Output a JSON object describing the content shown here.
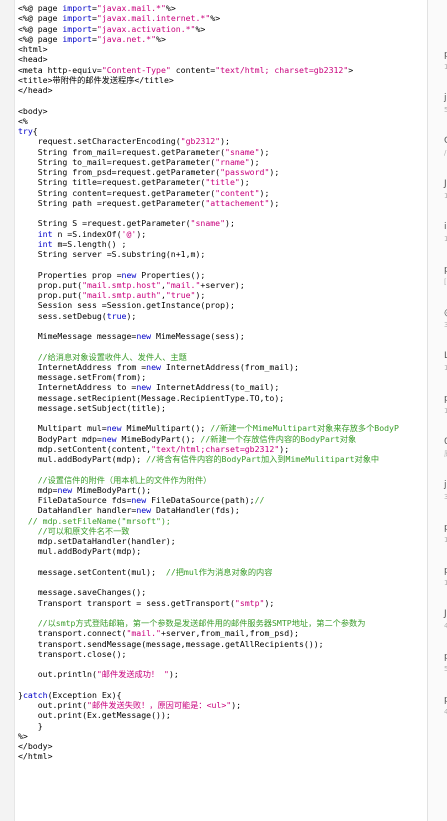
{
  "editor": {
    "lines": [
      [
        [
          "<%@ page ",
          ""
        ],
        [
          "import",
          "kw"
        ],
        [
          "=",
          ""
        ],
        [
          "\"javax.mail.*\"",
          "str"
        ],
        [
          "%>",
          ""
        ]
      ],
      [
        [
          "<%@ page ",
          ""
        ],
        [
          "import",
          "kw"
        ],
        [
          "=",
          ""
        ],
        [
          "\"javax.mail.internet.*\"",
          "str"
        ],
        [
          "%>",
          ""
        ]
      ],
      [
        [
          "<%@ page ",
          ""
        ],
        [
          "import",
          "kw"
        ],
        [
          "=",
          ""
        ],
        [
          "\"javax.activation.*\"",
          "str"
        ],
        [
          "%>",
          ""
        ]
      ],
      [
        [
          "<%@ page ",
          ""
        ],
        [
          "import",
          "kw"
        ],
        [
          "=",
          ""
        ],
        [
          "\"java.net.*\"",
          "str"
        ],
        [
          "%>",
          ""
        ]
      ],
      [
        [
          "<html>",
          ""
        ]
      ],
      [
        [
          "<head>",
          ""
        ]
      ],
      [
        [
          "<meta http-equiv=",
          ""
        ],
        [
          "\"Content-Type\"",
          "str"
        ],
        [
          " content=",
          ""
        ],
        [
          "\"text/html; charset=gb2312\"",
          "str"
        ],
        [
          ">",
          ""
        ]
      ],
      [
        [
          "<title>带附件的邮件发送程序</title>",
          ""
        ]
      ],
      [
        [
          "</head>",
          ""
        ]
      ],
      [
        [
          "",
          ""
        ]
      ],
      [
        [
          "<body>",
          ""
        ]
      ],
      [
        [
          "<%",
          ""
        ]
      ],
      [
        [
          "try",
          "kw"
        ],
        [
          "{",
          ""
        ]
      ],
      [
        [
          "    request.setCharacterEncoding(",
          ""
        ],
        [
          "\"gb2312\"",
          "str"
        ],
        [
          ");",
          ""
        ]
      ],
      [
        [
          "    String from_mail=request.getParameter(",
          ""
        ],
        [
          "\"sname\"",
          "str"
        ],
        [
          ");",
          ""
        ]
      ],
      [
        [
          "    String to_mail=request.getParameter(",
          ""
        ],
        [
          "\"rname\"",
          "str"
        ],
        [
          ");",
          ""
        ]
      ],
      [
        [
          "    String from_psd=request.getParameter(",
          ""
        ],
        [
          "\"password\"",
          "str"
        ],
        [
          ");",
          ""
        ]
      ],
      [
        [
          "    String title=request.getParameter(",
          ""
        ],
        [
          "\"title\"",
          "str"
        ],
        [
          ");",
          ""
        ]
      ],
      [
        [
          "    String content=request.getParameter(",
          ""
        ],
        [
          "\"content\"",
          "str"
        ],
        [
          ");",
          ""
        ]
      ],
      [
        [
          "    String path =request.getParameter(",
          ""
        ],
        [
          "\"attachement\"",
          "str"
        ],
        [
          ");",
          ""
        ]
      ],
      [
        [
          "",
          ""
        ]
      ],
      [
        [
          "    String S =request.getParameter(",
          ""
        ],
        [
          "\"sname\"",
          "str"
        ],
        [
          ");",
          ""
        ]
      ],
      [
        [
          "    int",
          "kw"
        ],
        [
          " n =S.indexOf(",
          ""
        ],
        [
          "'@'",
          "str"
        ],
        [
          ");",
          ""
        ]
      ],
      [
        [
          "    int",
          "kw"
        ],
        [
          " m=S.length() ;",
          ""
        ]
      ],
      [
        [
          "    String server =S.substring(n+1,m);",
          ""
        ]
      ],
      [
        [
          "",
          ""
        ]
      ],
      [
        [
          "    Properties prop =",
          ""
        ],
        [
          "new",
          "kw"
        ],
        [
          " Properties();",
          ""
        ]
      ],
      [
        [
          "    prop.put(",
          ""
        ],
        [
          "\"mail.smtp.host\"",
          "str"
        ],
        [
          ",",
          ""
        ],
        [
          "\"mail.\"",
          "str"
        ],
        [
          "+server);",
          ""
        ]
      ],
      [
        [
          "    prop.put(",
          ""
        ],
        [
          "\"mail.smtp.auth\"",
          "str"
        ],
        [
          ",",
          ""
        ],
        [
          "\"true\"",
          "str"
        ],
        [
          ");",
          ""
        ]
      ],
      [
        [
          "    Session sess =Session.getInstance(prop);",
          ""
        ]
      ],
      [
        [
          "    sess.setDebug(",
          ""
        ],
        [
          "true",
          "kw"
        ],
        [
          ");",
          ""
        ]
      ],
      [
        [
          "",
          ""
        ]
      ],
      [
        [
          "    MimeMessage message=",
          ""
        ],
        [
          "new",
          "kw"
        ],
        [
          " MimeMessage(sess);",
          ""
        ]
      ],
      [
        [
          "",
          ""
        ]
      ],
      [
        [
          "    //给消息对象设置收件人、发件人、主题",
          "cm"
        ]
      ],
      [
        [
          "    InternetAddress from =",
          ""
        ],
        [
          "new",
          "kw"
        ],
        [
          " InternetAddress(from_mail);",
          ""
        ]
      ],
      [
        [
          "    message.setFrom(from);",
          ""
        ]
      ],
      [
        [
          "    InternetAddress to =",
          ""
        ],
        [
          "new",
          "kw"
        ],
        [
          " InternetAddress(to_mail);",
          ""
        ]
      ],
      [
        [
          "    message.setRecipient(Message.RecipientType.TO,to);",
          ""
        ]
      ],
      [
        [
          "    message.setSubject(title);",
          ""
        ]
      ],
      [
        [
          "",
          ""
        ]
      ],
      [
        [
          "    Multipart mul=",
          ""
        ],
        [
          "new",
          "kw"
        ],
        [
          " MimeMultipart(); ",
          ""
        ],
        [
          "//新建一个MimeMultipart对象来存放多个BodyP",
          "cm"
        ]
      ],
      [
        [
          "    BodyPart mdp=",
          ""
        ],
        [
          "new",
          "kw"
        ],
        [
          " MimeBodyPart(); ",
          ""
        ],
        [
          "//新建一个存放信件内容的BodyPart对象",
          "cm"
        ]
      ],
      [
        [
          "    mdp.setContent(content,",
          ""
        ],
        [
          "\"text/html;charset=gb2312\"",
          "str"
        ],
        [
          ");",
          ""
        ]
      ],
      [
        [
          "    mul.addBodyPart(mdp); ",
          ""
        ],
        [
          "//将含有信件内容的BodyPart加入到MimeMulitipart对象中",
          "cm"
        ]
      ],
      [
        [
          "",
          ""
        ]
      ],
      [
        [
          "    //设置信件的附件（用本机上的文件作为附件）",
          "cm"
        ]
      ],
      [
        [
          "    mdp=",
          ""
        ],
        [
          "new",
          "kw"
        ],
        [
          " MimeBodyPart();",
          ""
        ]
      ],
      [
        [
          "    FileDataSource fds=",
          ""
        ],
        [
          "new",
          "kw"
        ],
        [
          " FileDataSource(path);",
          ""
        ],
        [
          "//",
          "cm"
        ]
      ],
      [
        [
          "    DataHandler handler=",
          ""
        ],
        [
          "new",
          "kw"
        ],
        [
          " DataHandler(fds);",
          ""
        ]
      ],
      [
        [
          "  // mdp.setFileName(\"mrsoft\");",
          "cm"
        ]
      ],
      [
        [
          "    //可以和原文件名不一致",
          "cm"
        ]
      ],
      [
        [
          "    mdp.setDataHandler(handler);",
          ""
        ]
      ],
      [
        [
          "    mul.addBodyPart(mdp);",
          ""
        ]
      ],
      [
        [
          "",
          ""
        ]
      ],
      [
        [
          "    message.setContent(mul);  ",
          ""
        ],
        [
          "//把mul作为消息对象的内容",
          "cm"
        ]
      ],
      [
        [
          "",
          ""
        ]
      ],
      [
        [
          "    message.saveChanges();",
          ""
        ]
      ],
      [
        [
          "    Transport transport = sess.getTransport(",
          ""
        ],
        [
          "\"smtp\"",
          "str"
        ],
        [
          ");",
          ""
        ]
      ],
      [
        [
          "",
          ""
        ]
      ],
      [
        [
          "    //以smtp方式登陆邮箱，第一个参数是发送邮件用的邮件服务器SMTP地址，第二个参数为",
          "cm"
        ]
      ],
      [
        [
          "    transport.connect(",
          ""
        ],
        [
          "\"mail.\"",
          "str"
        ],
        [
          "+server,from_mail,from_psd);",
          ""
        ]
      ],
      [
        [
          "    transport.sendMessage(message,message.getAllRecipients());",
          ""
        ]
      ],
      [
        [
          "    transport.close();",
          ""
        ]
      ],
      [
        [
          "",
          ""
        ]
      ],
      [
        [
          "    out.println(",
          ""
        ],
        [
          "\"邮件发送成功！ \"",
          "str"
        ],
        [
          ");",
          ""
        ]
      ],
      [
        [
          "",
          ""
        ]
      ],
      [
        [
          "}",
          ""
        ],
        [
          "catch",
          "kw"
        ],
        [
          "(Exception Ex){",
          ""
        ]
      ],
      [
        [
          "    out.print(",
          ""
        ],
        [
          "\"邮件发送失败！，原因可能是：<ul>\"",
          "str"
        ],
        [
          ");",
          ""
        ]
      ],
      [
        [
          "    out.print(Ex.getMessage());",
          ""
        ]
      ],
      [
        [
          "    }",
          ""
        ]
      ],
      [
        [
          "%>",
          ""
        ]
      ],
      [
        [
          "</body>",
          ""
        ]
      ],
      [
        [
          "</html>",
          ""
        ]
      ]
    ]
  },
  "right_pane": {
    "fragments": [
      {
        "text": "p",
        "style": "main"
      },
      {
        "text": "1",
        "style": "sub"
      },
      {
        "text": "je",
        "style": "main"
      },
      {
        "text": "5",
        "style": "sub"
      },
      {
        "text": "C",
        "style": "main"
      },
      {
        "text": "/",
        "style": "sub"
      },
      {
        "text": "J",
        "style": "main"
      },
      {
        "text": "1",
        "style": "sub"
      },
      {
        "text": "i",
        "style": "main"
      },
      {
        "text": "1",
        "style": "sub"
      },
      {
        "text": "p",
        "style": "main"
      },
      {
        "text": "[",
        "style": "sub"
      },
      {
        "text": "@",
        "style": "main"
      },
      {
        "text": "3",
        "style": "sub"
      },
      {
        "text": "L",
        "style": "main"
      },
      {
        "text": "1",
        "style": "sub"
      },
      {
        "text": "p",
        "style": "main"
      },
      {
        "text": "1",
        "style": "sub"
      },
      {
        "text": "0",
        "style": "main"
      },
      {
        "text": "原",
        "style": "sub"
      },
      {
        "text": "je",
        "style": "main"
      },
      {
        "text": "3",
        "style": "sub"
      },
      {
        "text": "p",
        "style": "main"
      },
      {
        "text": "1",
        "style": "sub"
      },
      {
        "text": "p",
        "style": "main"
      },
      {
        "text": "1",
        "style": "sub"
      },
      {
        "text": "J",
        "style": "main"
      },
      {
        "text": "4",
        "style": "sub"
      },
      {
        "text": "p",
        "style": "main"
      },
      {
        "text": "5",
        "style": "sub"
      },
      {
        "text": "p",
        "style": "main"
      },
      {
        "text": "4",
        "style": "sub"
      }
    ]
  }
}
